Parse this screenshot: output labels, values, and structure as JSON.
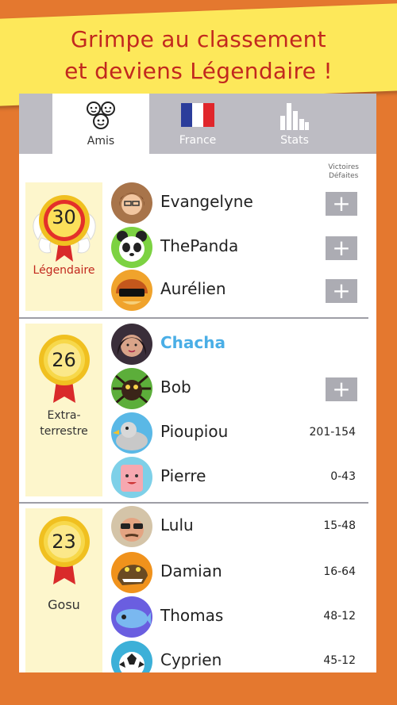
{
  "banner": {
    "line1": "Grimpe au classement",
    "line2": "et deviens Légendaire !"
  },
  "tabs": [
    {
      "label": "Amis",
      "icon": "friends-icon",
      "active": true
    },
    {
      "label": "France",
      "icon": "france-flag-icon",
      "active": false
    },
    {
      "label": "Stats",
      "icon": "bar-chart-icon",
      "active": false
    }
  ],
  "column_header": {
    "wins": "Victoires",
    "losses": "Défaites"
  },
  "colors": {
    "accent": "#c2281e",
    "highlight": "#4aaee6",
    "banner": "#fde85a",
    "background": "#e4782f"
  },
  "sections": [
    {
      "level": "30",
      "rank": "Légendaire",
      "players": [
        {
          "name": "Evangelyne",
          "action": "+"
        },
        {
          "name": "ThePanda",
          "action": "+"
        },
        {
          "name": "Aurélien",
          "action": "+"
        }
      ]
    },
    {
      "level": "26",
      "rank": "Extra-terrestre",
      "rank_lines": [
        "Extra-",
        "terrestre"
      ],
      "players": [
        {
          "name": "Chacha",
          "is_me": true
        },
        {
          "name": "Bob",
          "action": "+"
        },
        {
          "name": "Pioupiou",
          "score": "201-154"
        },
        {
          "name": "Pierre",
          "score": "0-43"
        }
      ]
    },
    {
      "level": "23",
      "rank": "Gosu",
      "players": [
        {
          "name": "Lulu",
          "score": "15-48"
        },
        {
          "name": "Damian",
          "score": "16-64"
        },
        {
          "name": "Thomas",
          "score": "48-12"
        },
        {
          "name": "Cyprien",
          "score": "45-12"
        }
      ]
    }
  ]
}
